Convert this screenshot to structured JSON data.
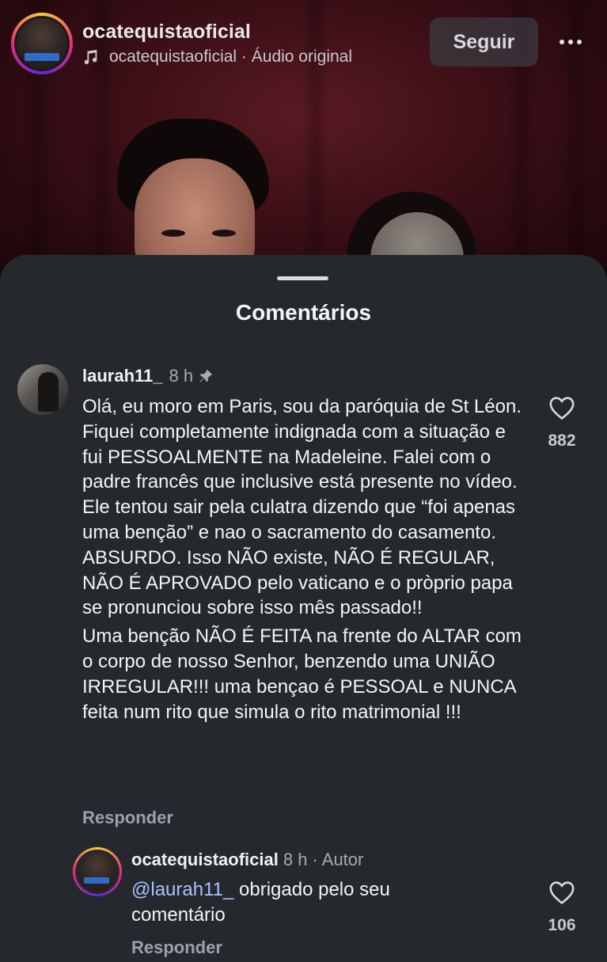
{
  "header": {
    "channel_name": "ocatequistaoficial",
    "audio_label": "ocatequistaoficial · Áudio original",
    "follow_label": "Seguir"
  },
  "comments_sheet": {
    "title": "Comentários",
    "comment": {
      "username": "laurah11_",
      "time": "8 h",
      "pinned": true,
      "paragraphs": [
        "Olá, eu moro em Paris, sou da paróquia de St Léon. Fiquei completamente indignada com a situação e fui PESSOALMENTE na Madeleine. Falei com o padre francês que inclusive está presente no vídeo. Ele tentou sair pela culatra dizendo que “foi apenas uma benção” e nao o sacramento do casamento. ABSURDO. Isso NÃO existe, NÃO É REGULAR, NÃO É APROVADO pelo vaticano e o pròprio papa se pronunciou sobre isso mês passado!!",
        "Uma benção NÃO É FEITA na frente do ALTAR com o corpo de nosso Senhor, benzendo uma UNIÃO IRREGULAR!!! uma bençao é PESSOAL e NUNCA feita num rito que simula o rito matrimonial !!!"
      ],
      "reply_label": "Responder",
      "like_count": "882"
    },
    "reply": {
      "username": "ocatequistaoficial",
      "meta": "8 h · Autor",
      "mention": "@laurah11_",
      "text": " obrigado pelo seu comentário",
      "reply_label": "Responder",
      "like_count": "106"
    }
  },
  "colors": {
    "sheet_bg": "#25292e",
    "mention": "#a7c3ff",
    "secondary_text": "#a8abb0"
  }
}
